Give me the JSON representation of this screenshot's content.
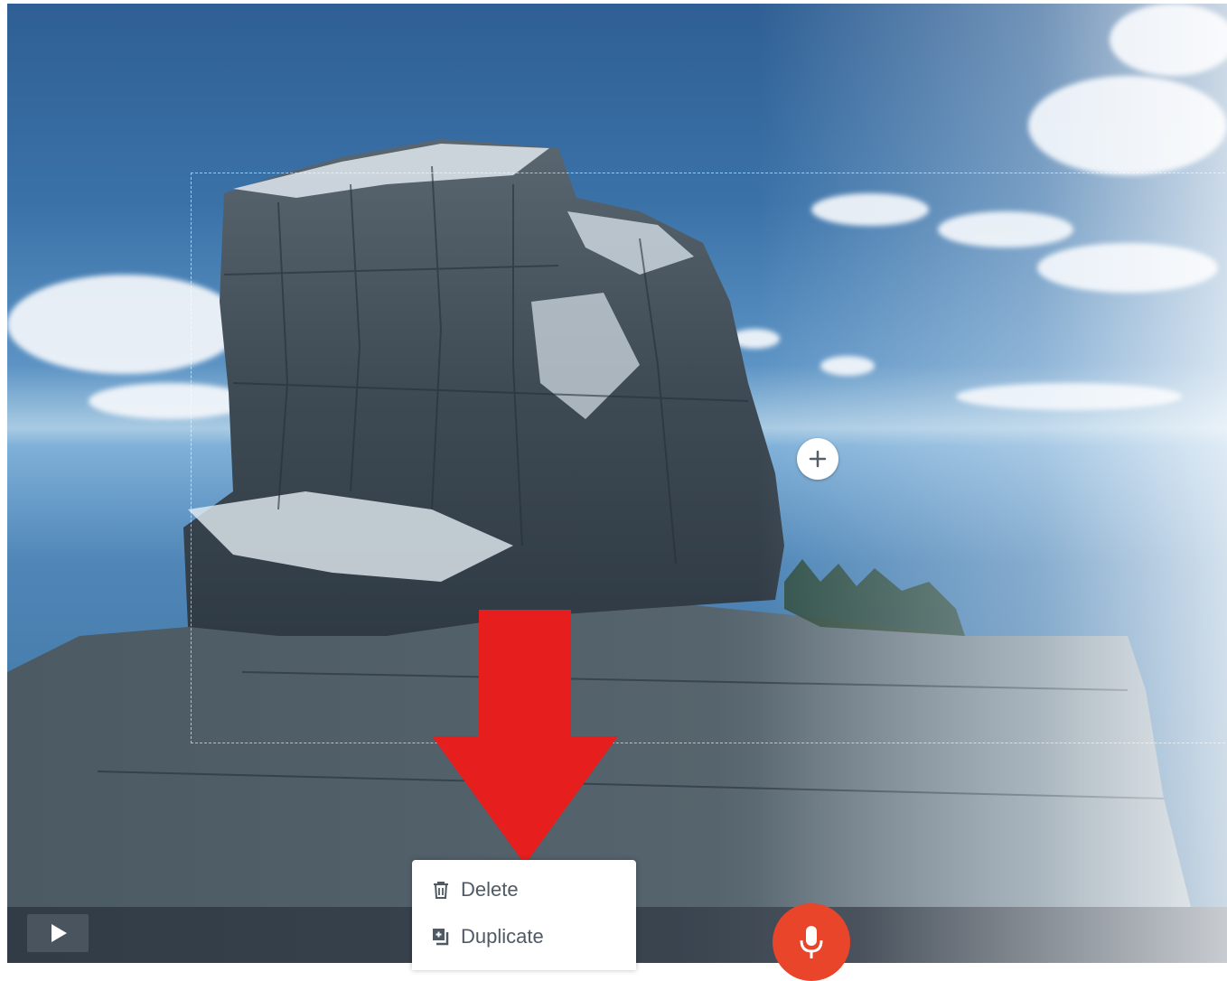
{
  "canvas": {
    "selection_visible": true
  },
  "add_button": {
    "icon": "plus-icon"
  },
  "toolbar": {
    "play_icon": "play-icon",
    "mic_icon": "microphone-icon",
    "mic_color": "#e8452a"
  },
  "context_menu": {
    "items": [
      {
        "label": "Delete",
        "icon": "trash-icon"
      },
      {
        "label": "Duplicate",
        "icon": "duplicate-icon"
      }
    ]
  },
  "annotation": {
    "arrow_color": "#e61e1e"
  }
}
